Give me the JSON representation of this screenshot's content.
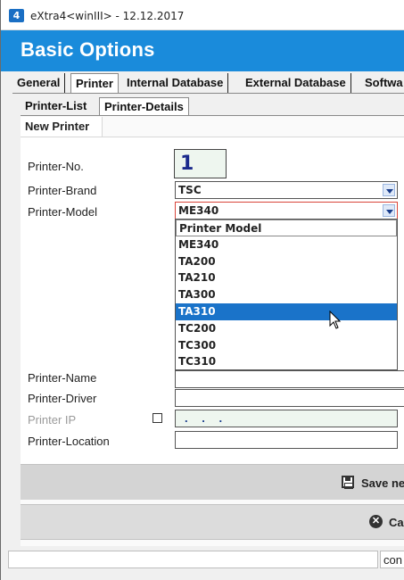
{
  "window": {
    "title": "eXtra4<winIII>  -  12.12.2017",
    "icon": "app-logo-icon"
  },
  "header": {
    "title": "Basic Options"
  },
  "main_tabs": [
    {
      "label": "General"
    },
    {
      "label": "Printer",
      "active": true
    },
    {
      "label": "Internal Database"
    },
    {
      "label": "External Database"
    },
    {
      "label": "Softwa"
    }
  ],
  "sub_tabs": [
    {
      "label": "Printer-List"
    },
    {
      "label": "Printer-Details",
      "active": true
    }
  ],
  "inner_tab": {
    "label": "New Printer"
  },
  "form": {
    "printer_no": {
      "label": "Printer-No.",
      "value": "1"
    },
    "printer_brand": {
      "label": "Printer-Brand",
      "value": "TSC"
    },
    "printer_model": {
      "label": "Printer-Model",
      "value": "ME340",
      "dropdown_header": "Printer Model",
      "options": [
        "ME340",
        "TA200",
        "TA210",
        "TA300",
        "TA310",
        "TC200",
        "TC300",
        "TC310"
      ],
      "highlighted": "TA310"
    },
    "printer_name": {
      "label": "Printer-Name",
      "value": ""
    },
    "printer_driver": {
      "label": "Printer-Driver",
      "value": ""
    },
    "printer_ip": {
      "label": "Printer IP",
      "value": ". . .",
      "checked": false
    },
    "printer_location": {
      "label": "Printer-Location",
      "value": ""
    }
  },
  "buttons": {
    "save": "Save nev",
    "cancel": "Ca"
  },
  "status": {
    "right_text": "con"
  },
  "colors": {
    "header_bg": "#1a8bdb",
    "selection": "#1a73c9",
    "active_border": "#d9453a"
  }
}
